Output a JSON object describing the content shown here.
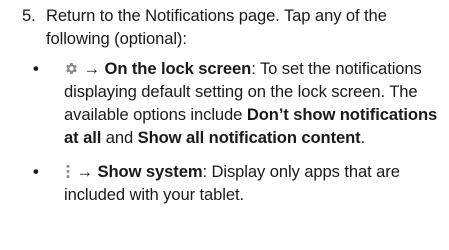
{
  "step": {
    "number": "5.",
    "text": "Return to the Notifications page. Tap any of the following (optional):"
  },
  "bullets": [
    {
      "marker": "•",
      "icon": "gear-icon",
      "arrow": "→",
      "title": "On the lock screen",
      "colon": ":",
      "desc": "To set the notifications displaying default setting on the lock screen. The available options include",
      "option1": "Don’t show notifications at all",
      "and": "and",
      "option2": "Show all notification content",
      "end": "."
    },
    {
      "marker": "•",
      "icon": "more-options-icon",
      "arrow": "→",
      "title": "Show system",
      "colon": ":",
      "desc": "Display only apps that are included with your tablet."
    }
  ]
}
